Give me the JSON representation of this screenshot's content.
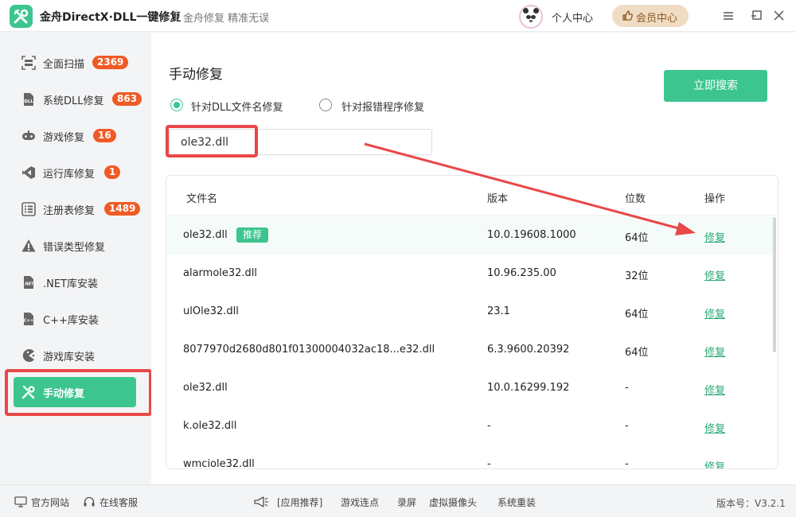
{
  "app": {
    "title": "金舟DirectX·DLL一键修复",
    "slogan": "金舟修复 精准无误",
    "user_center": "个人中心",
    "vip": "会员中心"
  },
  "sidebar": {
    "items": [
      {
        "label": "全面扫描",
        "badge": "2369",
        "icon": "scan-icon"
      },
      {
        "label": "系统DLL修复",
        "badge": "863",
        "icon": "dll-icon"
      },
      {
        "label": "游戏修复",
        "badge": "16",
        "icon": "gamepad-icon"
      },
      {
        "label": "运行库修复",
        "badge": "1",
        "icon": "runtime-icon"
      },
      {
        "label": "注册表修复",
        "badge": "1489",
        "icon": "registry-icon"
      },
      {
        "label": "错误类型修复",
        "badge": "",
        "icon": "warning-icon"
      },
      {
        "label": ".NET库安装",
        "badge": "",
        "icon": "dotnet-icon"
      },
      {
        "label": "C++库安装",
        "badge": "",
        "icon": "cpp-icon"
      },
      {
        "label": "游戏库安装",
        "badge": "",
        "icon": "pacman-icon"
      },
      {
        "label": "手动修复",
        "badge": "",
        "icon": "tools-icon"
      }
    ]
  },
  "main": {
    "title": "手动修复",
    "search_button": "立即搜索",
    "radio_options": [
      "针对DLL文件名修复",
      "针对报错程序修复"
    ],
    "search_value": "ole32.dll",
    "table": {
      "headers": [
        "文件名",
        "版本",
        "位数",
        "操作"
      ],
      "recommend_tag": "推荐",
      "rows": [
        {
          "name": "ole32.dll",
          "version": "10.0.19608.1000",
          "bits": "64位",
          "action": "修复"
        },
        {
          "name": "alarmole32.dll",
          "version": "10.96.235.00",
          "bits": "32位",
          "action": "修复"
        },
        {
          "name": "ulOle32.dll",
          "version": "23.1",
          "bits": "64位",
          "action": "修复"
        },
        {
          "name": "8077970d2680d801f01300004032ac18...e32.dll",
          "version": "6.3.9600.20392",
          "bits": "64位",
          "action": "修复"
        },
        {
          "name": "ole32.dll",
          "version": "10.0.16299.192",
          "bits": "-",
          "action": "修复"
        },
        {
          "name": "k.ole32.dll",
          "version": "-",
          "bits": "-",
          "action": "修复"
        },
        {
          "name": "wmciole32.dll",
          "version": "-",
          "bits": "-",
          "action": "修复"
        }
      ]
    }
  },
  "footer": {
    "official_site": "官方网站",
    "online_service": "在线客服",
    "app_recommend": "[应用推荐]",
    "links": [
      "游戏连点",
      "录屏",
      "虚拟摄像头",
      "系统重装"
    ],
    "version": "版本号：V3.2.1"
  },
  "colors": {
    "accent": "#3cc58f",
    "badge": "#f05a24",
    "highlight": "#e84848",
    "link": "#2aa875"
  }
}
